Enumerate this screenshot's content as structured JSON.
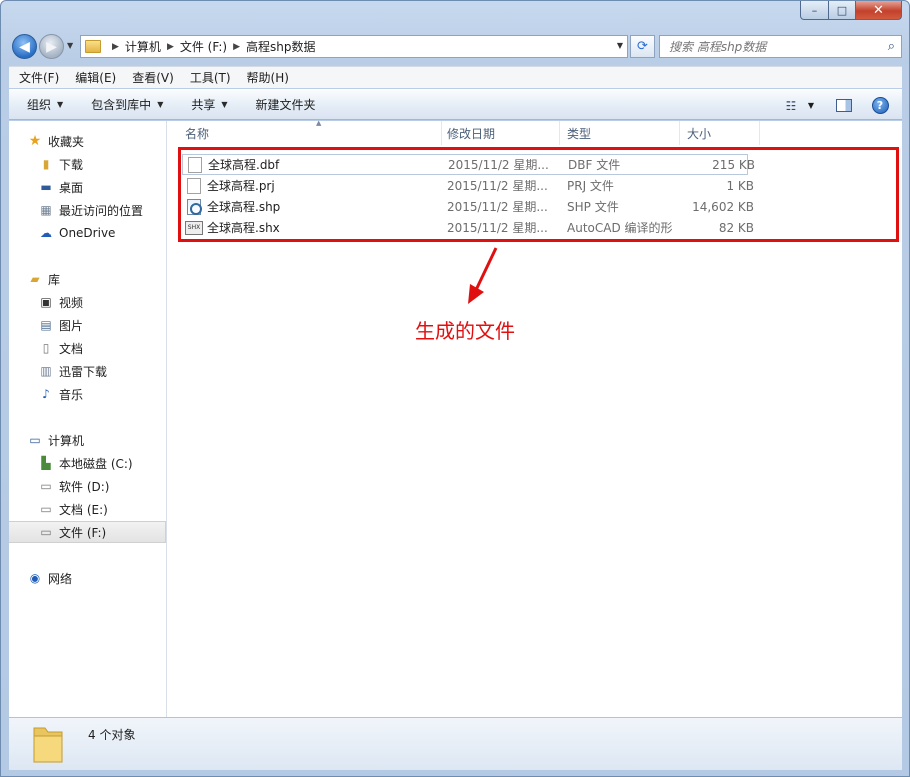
{
  "window": {
    "controls": {
      "minimize": "–",
      "maximize": "□",
      "close": "✕"
    }
  },
  "nav": {
    "back": "◀",
    "forward": "▶",
    "path": [
      "计算机",
      "文件 (F:)",
      "高程shp数据"
    ],
    "search_placeholder": "搜索 高程shp数据"
  },
  "menubar": [
    "文件(F)",
    "编辑(E)",
    "查看(V)",
    "工具(T)",
    "帮助(H)"
  ],
  "toolbar": {
    "organize": "组织",
    "include_library": "包含到库中",
    "share": "共享",
    "new_folder": "新建文件夹"
  },
  "sidebar": {
    "favorites": {
      "label": "收藏夹",
      "items": [
        "下载",
        "桌面",
        "最近访问的位置",
        "OneDrive"
      ]
    },
    "libraries": {
      "label": "库",
      "items": [
        "视频",
        "图片",
        "文档",
        "迅雷下载",
        "音乐"
      ]
    },
    "computer": {
      "label": "计算机",
      "items": [
        "本地磁盘 (C:)",
        "软件 (D:)",
        "文档 (E:)",
        "文件 (F:)"
      ]
    },
    "network": {
      "label": "网络"
    }
  },
  "columns": {
    "name": "名称",
    "date": "修改日期",
    "type": "类型",
    "size": "大小"
  },
  "files": [
    {
      "name": "全球高程.dbf",
      "date": "2015/11/2 星期...",
      "type": "DBF 文件",
      "size": "215 KB",
      "icon": "generic-file-icon"
    },
    {
      "name": "全球高程.prj",
      "date": "2015/11/2 星期...",
      "type": "PRJ 文件",
      "size": "1 KB",
      "icon": "generic-file-icon"
    },
    {
      "name": "全球高程.shp",
      "date": "2015/11/2 星期...",
      "type": "SHP 文件",
      "size": "14,602 KB",
      "icon": "shp-file-icon"
    },
    {
      "name": "全球高程.shx",
      "date": "2015/11/2 星期...",
      "type": "AutoCAD 编译的形",
      "size": "82 KB",
      "icon": "shx-file-icon"
    }
  ],
  "annotation": {
    "text": "生成的文件",
    "color": "#e01010"
  },
  "status": {
    "count": "4 个对象"
  }
}
